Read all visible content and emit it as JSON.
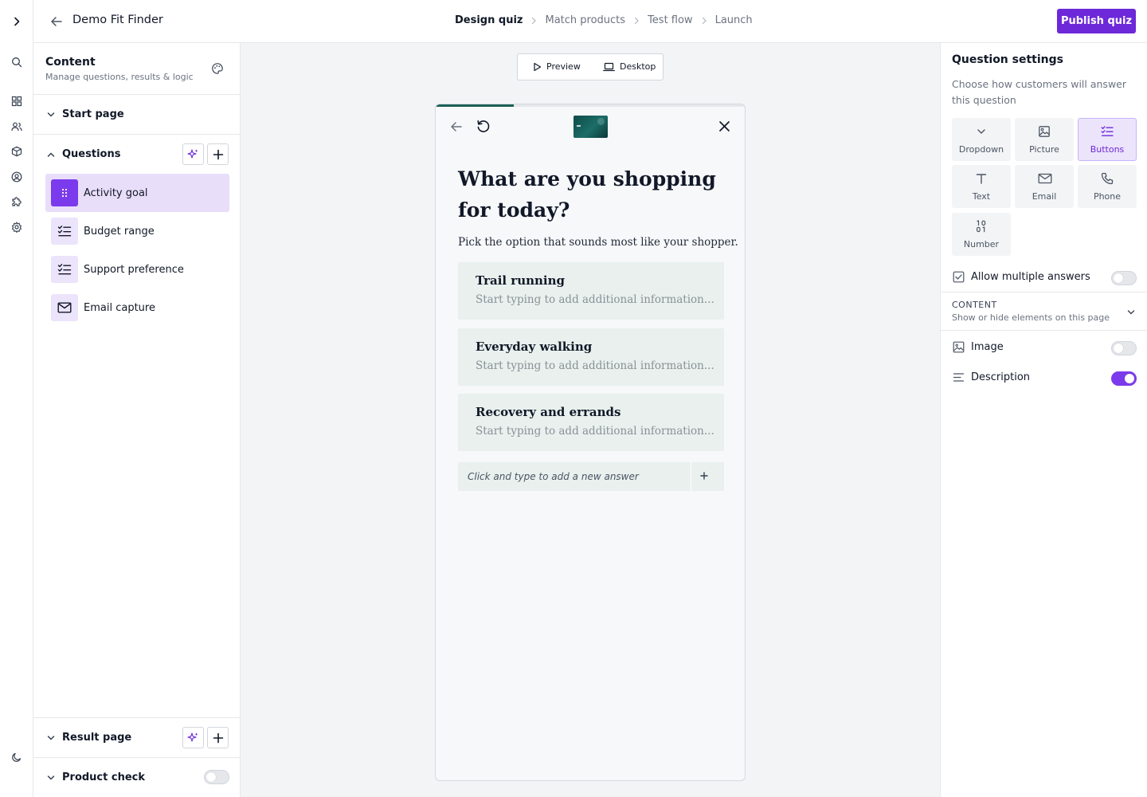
{
  "app": {
    "title": "Demo Fit Finder",
    "publish_label": "Publish quiz"
  },
  "steps": [
    {
      "label": "Design quiz",
      "active": true
    },
    {
      "label": "Match products",
      "active": false
    },
    {
      "label": "Test flow",
      "active": false
    },
    {
      "label": "Launch",
      "active": false
    }
  ],
  "rail": {
    "icons": [
      "expand-chevron-icon",
      "search-icon",
      "dashboard-icon",
      "users-icon",
      "box-icon",
      "account-icon",
      "puzzle-icon",
      "settings-icon",
      "theme-moon-icon"
    ]
  },
  "content_panel": {
    "title": "Content",
    "subtitle": "Manage questions, results & logic",
    "start_page_label": "Start page",
    "questions_label": "Questions",
    "questions": [
      {
        "label": "Activity goal",
        "icon": "drag-handle-icon",
        "active": true
      },
      {
        "label": "Budget range",
        "icon": "checklist-icon",
        "active": false
      },
      {
        "label": "Support preference",
        "icon": "checklist-icon",
        "active": false
      },
      {
        "label": "Email capture",
        "icon": "mail-icon",
        "active": false
      }
    ],
    "result_page_label": "Result page",
    "product_check_label": "Product check",
    "product_check_enabled": false
  },
  "canvas": {
    "preview_label": "Preview",
    "device_label": "Desktop",
    "progress_fraction": 0.25,
    "question": "What are you shopping for today?",
    "description": "Pick the option that sounds most like your shopper.",
    "answers": [
      {
        "title": "Trail running",
        "placeholder": "Start typing to add additional information..."
      },
      {
        "title": "Everyday walking",
        "placeholder": "Start typing to add additional information..."
      },
      {
        "title": "Recovery and errands",
        "placeholder": "Start typing to add additional information..."
      }
    ],
    "new_answer_placeholder": "Click and type to add a new answer"
  },
  "settings": {
    "title": "Question settings",
    "subtitle": "Choose how customers will answer this question",
    "types": [
      {
        "label": "Dropdown",
        "icon": "chevron-down-icon",
        "active": false
      },
      {
        "label": "Picture",
        "icon": "image-icon",
        "active": false
      },
      {
        "label": "Buttons",
        "icon": "checklist-icon",
        "active": true
      },
      {
        "label": "Text",
        "icon": "text-icon",
        "active": false
      },
      {
        "label": "Email",
        "icon": "mail-icon",
        "active": false
      },
      {
        "label": "Phone",
        "icon": "phone-icon",
        "active": false
      },
      {
        "label": "Number",
        "icon": "number-icon",
        "active": false
      }
    ],
    "allow_multiple_label": "Allow multiple answers",
    "allow_multiple_enabled": false,
    "content_title": "CONTENT",
    "content_subtitle": "Show or hide elements on this page",
    "image_label": "Image",
    "image_enabled": false,
    "description_label": "Description",
    "description_enabled": true
  },
  "colors": {
    "brand": "#6d28d9",
    "accent_light": "#ece4fb",
    "progress": "#1a5f58",
    "answer_bg": "#e9f0ee"
  }
}
